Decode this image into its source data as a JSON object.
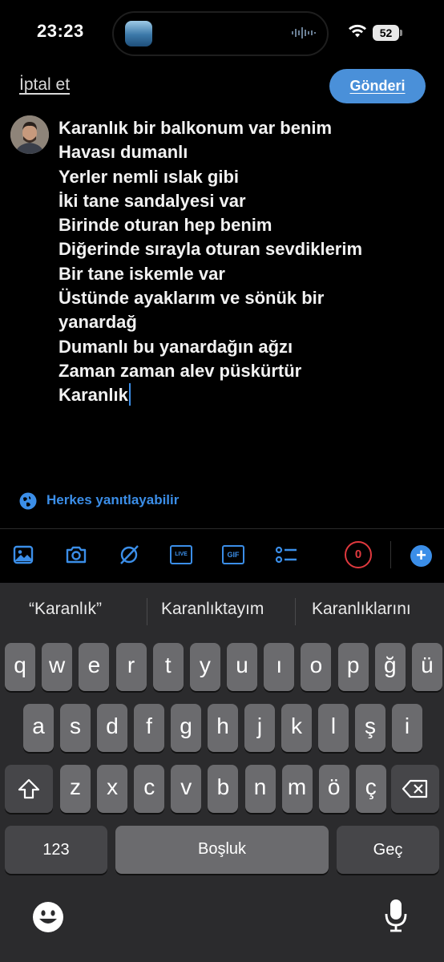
{
  "status_bar": {
    "time": "23:23",
    "battery": "52"
  },
  "header": {
    "cancel_label": "İptal et",
    "post_label": "Gönderi"
  },
  "composer": {
    "lines": [
      "Karanlık bir balkonum var benim",
      "Havası dumanlı",
      "Yerler nemli ıslak gibi",
      "İki tane sandalyesi var",
      "Birinde oturan hep benim",
      "Diğerinde sırayla oturan sevdiklerim",
      "Bir tane iskemle var",
      "Üstünde ayaklarım ve sönük bir",
      "yanardağ",
      "Dumanlı bu yanardağın ağzı",
      "Zaman zaman alev püskürtür",
      "Karanlık"
    ]
  },
  "reply_setting": {
    "label": "Herkes yanıtlayabilir"
  },
  "toolbar": {
    "icons": [
      "image-icon",
      "camera-icon",
      "grok-icon",
      "live-icon",
      "gif-icon",
      "poll-icon"
    ],
    "live_text": "LIVE",
    "gif_text": "GIF",
    "char_counter": "0",
    "add_symbol": "+"
  },
  "keyboard": {
    "suggestions": [
      "“Karanlık”",
      "Karanlıktayım",
      "Karanlıklarını"
    ],
    "row1": [
      "q",
      "w",
      "e",
      "r",
      "t",
      "y",
      "u",
      "ı",
      "o",
      "p",
      "ğ",
      "ü"
    ],
    "row2": [
      "a",
      "s",
      "d",
      "f",
      "g",
      "h",
      "j",
      "k",
      "l",
      "ş",
      "i"
    ],
    "row3": [
      "z",
      "x",
      "c",
      "v",
      "b",
      "n",
      "m",
      "ö",
      "ç"
    ],
    "numbers_label": "123",
    "space_label": "Boşluk",
    "return_label": "Geç"
  },
  "colors": {
    "accent": "#3b8ee8",
    "post_button": "#4a90d9",
    "counter": "#e0393e",
    "keyboard_bg": "#2b2b2d",
    "key": "#6b6b6e"
  }
}
